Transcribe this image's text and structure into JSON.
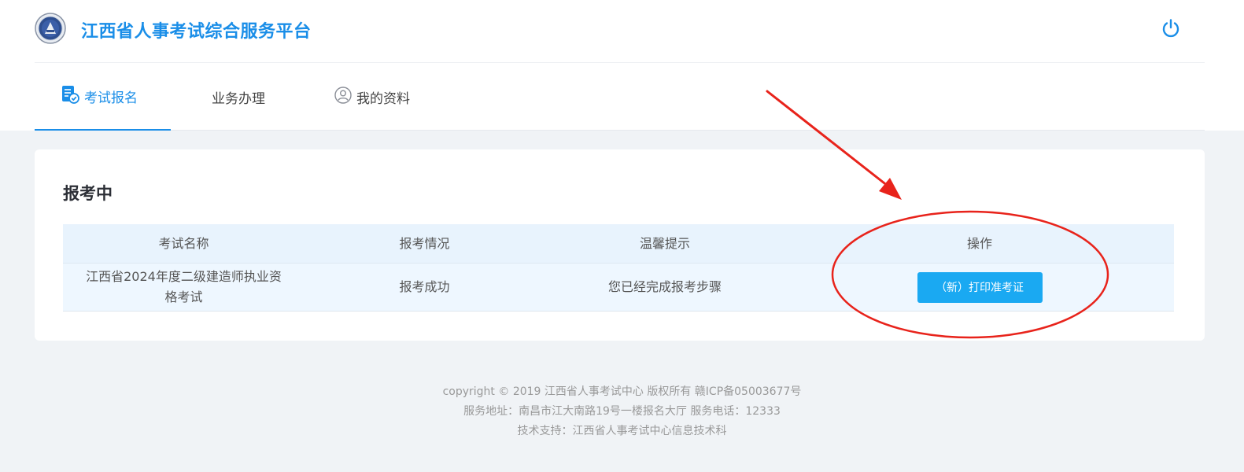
{
  "header": {
    "site_title": "江西省人事考试综合服务平台",
    "logo_icon": "emblem-icon",
    "logout_icon": "power-icon"
  },
  "nav": {
    "tabs": [
      {
        "label": "考试报名",
        "icon": "document-check-icon",
        "active": true
      },
      {
        "label": "业务办理",
        "active": false
      },
      {
        "label": "我的资料",
        "icon": "user-circle-icon",
        "active": false
      }
    ]
  },
  "main": {
    "section_title": "报考中",
    "table": {
      "headers": [
        "考试名称",
        "报考情况",
        "温馨提示",
        "操作"
      ],
      "rows": [
        {
          "exam_name": "江西省2024年度二级建造师执业资格考试",
          "status": "报考成功",
          "tip": "您已经完成报考步骤",
          "action_label": "（新）打印准考证"
        }
      ]
    }
  },
  "footer": {
    "line1": "copyright © 2019 江西省人事考试中心 版权所有 赣ICP备05003677号",
    "line2": "服务地址：南昌市江大南路19号一楼报名大厅 服务电话：12333",
    "line3": "技术支持：江西省人事考试中心信息技术科"
  },
  "colors": {
    "brand": "#1a8ee8",
    "button": "#1aa9f2",
    "annotation": "#e8231b"
  }
}
